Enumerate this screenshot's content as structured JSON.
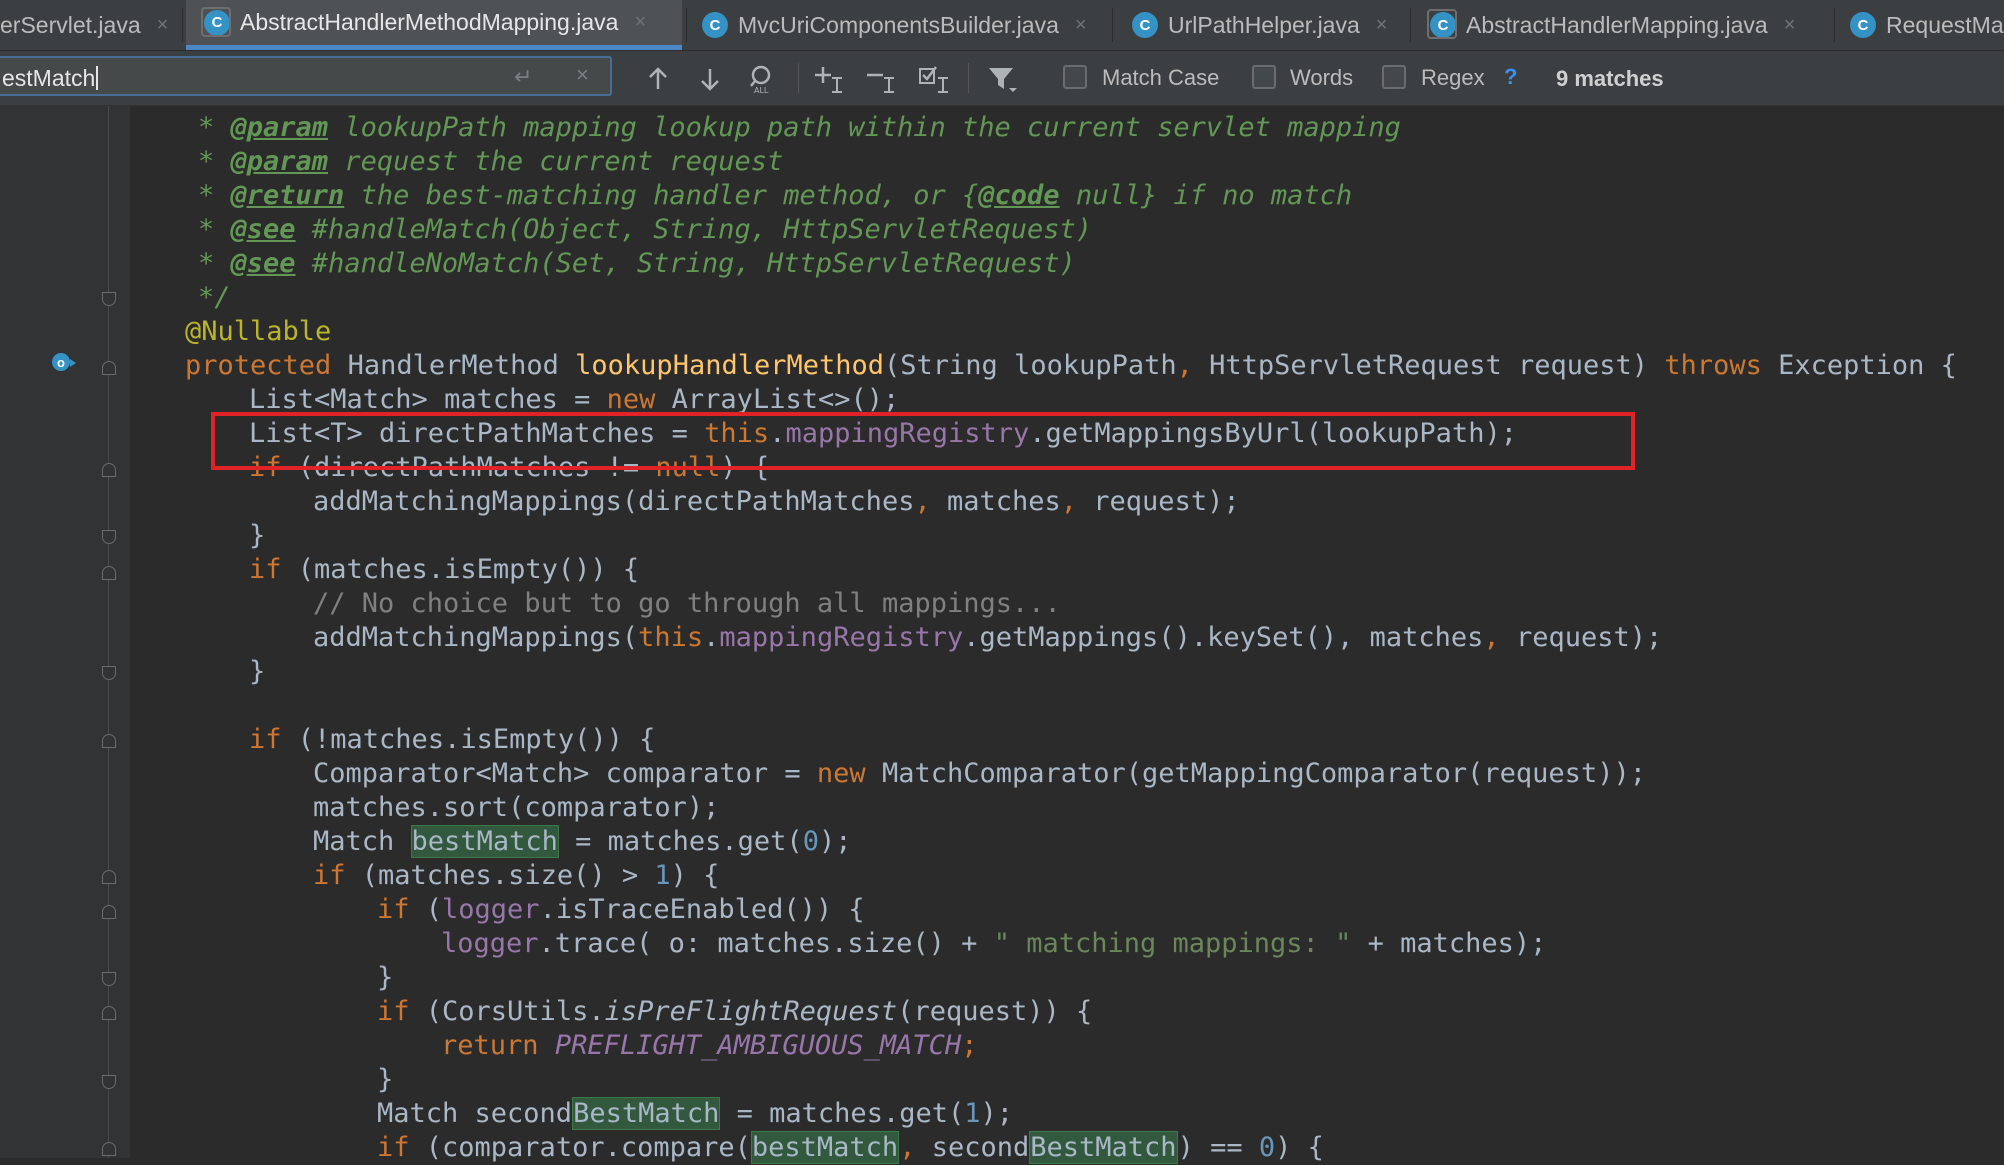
{
  "tabs": [
    {
      "label": "erServlet.java",
      "active": false
    },
    {
      "label": "AbstractHandlerMethodMapping.java",
      "active": true
    },
    {
      "label": "MvcUriComponentsBuilder.java",
      "active": false
    },
    {
      "label": "UrlPathHelper.java",
      "active": false
    },
    {
      "label": "AbstractHandlerMapping.java",
      "active": false
    },
    {
      "label": "RequestMap",
      "active": false
    }
  ],
  "tab_close_glyph": "×",
  "class_icon_letter": "C",
  "search": {
    "query": "estMatch",
    "options": {
      "match_case": "Match Case",
      "words": "Words",
      "regex": "Regex"
    },
    "help": "?",
    "match_count": "9 matches"
  },
  "code_lines": [
    "* @param lookupPath mapping lookup path within the current servlet mapping",
    "* @param request the current request",
    "* @return the best-matching handler method, or {@code null} if no match",
    "* @see #handleMatch(Object, String, HttpServletRequest)",
    "* @see #handleNoMatch(Set, String, HttpServletRequest)",
    "*/",
    "@Nullable",
    "protected HandlerMethod lookupHandlerMethod(String lookupPath, HttpServletRequest request) throws Exception {",
    "List<Match> matches = new ArrayList<>();",
    "List<T> directPathMatches = this.mappingRegistry.getMappingsByUrl(lookupPath);",
    "if (directPathMatches != null) {",
    "addMatchingMappings(directPathMatches, matches, request);",
    "}",
    "if (matches.isEmpty()) {",
    "// No choice but to go through all mappings...",
    "addMatchingMappings(this.mappingRegistry.getMappings().keySet(), matches, request);",
    "}",
    "if (!matches.isEmpty()) {",
    "Comparator<Match> comparator = new MatchComparator(getMappingComparator(request));",
    "matches.sort(comparator);",
    "Match bestMatch = matches.get(0);",
    "if (matches.size() > 1) {",
    "if (logger.isTraceEnabled()) {",
    "logger.trace( o: matches.size() + \" matching mappings: \" + matches);",
    "}",
    "if (CorsUtils.isPreFlightRequest(request)) {",
    "return PREFLIGHT_AMBIGUOUS_MATCH;",
    "}",
    "Match secondBestMatch = matches.get(1);",
    "if (comparator.compare(bestMatch, secondBestMatch) == 0) {"
  ],
  "colors": {
    "editor_bg": "#2b2b2b",
    "keyword": "#cc7832",
    "method": "#ffc66d",
    "field": "#9876aa",
    "string": "#6a8759",
    "number": "#6897bb",
    "javadoc": "#629755",
    "annotation": "#bbb529",
    "search_highlight": "#32593d",
    "red_box": "#e12227"
  }
}
